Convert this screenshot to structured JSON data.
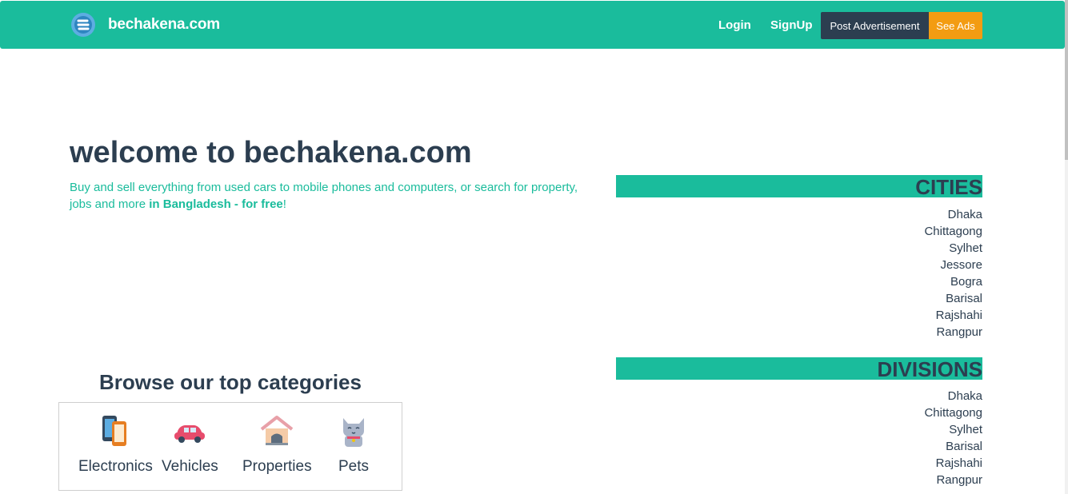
{
  "brand": {
    "name": "bechakena.com",
    "logo_icon": "bechakena-logo-icon"
  },
  "nav": {
    "login": "Login",
    "signup": "SignUp",
    "post_ad": "Post Advertisement",
    "see_ads": "See Ads"
  },
  "colors": {
    "primary": "#1abc9c",
    "dark": "#2c3e50",
    "accent": "#f39c12"
  },
  "hero": {
    "title_prefix": "welcome to ",
    "title_site": "bechakena.com",
    "subtitle_text": "Buy and sell everything from used cars to mobile phones and computers, or search for property, jobs and more ",
    "subtitle_bold": "in Bangladesh - for free",
    "subtitle_end": "!"
  },
  "categories": {
    "title": "Browse our top categories",
    "items": [
      {
        "label": "Electronics",
        "icon": "smartphone-icon"
      },
      {
        "label": "Vehicles",
        "icon": "car-icon"
      },
      {
        "label": "Properties",
        "icon": "house-icon"
      },
      {
        "label": "Pets",
        "icon": "cat-icon"
      }
    ]
  },
  "cities": {
    "title": "CITIES",
    "items": [
      "Dhaka",
      "Chittagong",
      "Sylhet",
      "Jessore",
      "Bogra",
      "Barisal",
      "Rajshahi",
      "Rangpur"
    ]
  },
  "divisions": {
    "title": "DIVISIONS",
    "items": [
      "Dhaka",
      "Chittagong",
      "Sylhet",
      "Barisal",
      "Rajshahi",
      "Rangpur"
    ]
  }
}
